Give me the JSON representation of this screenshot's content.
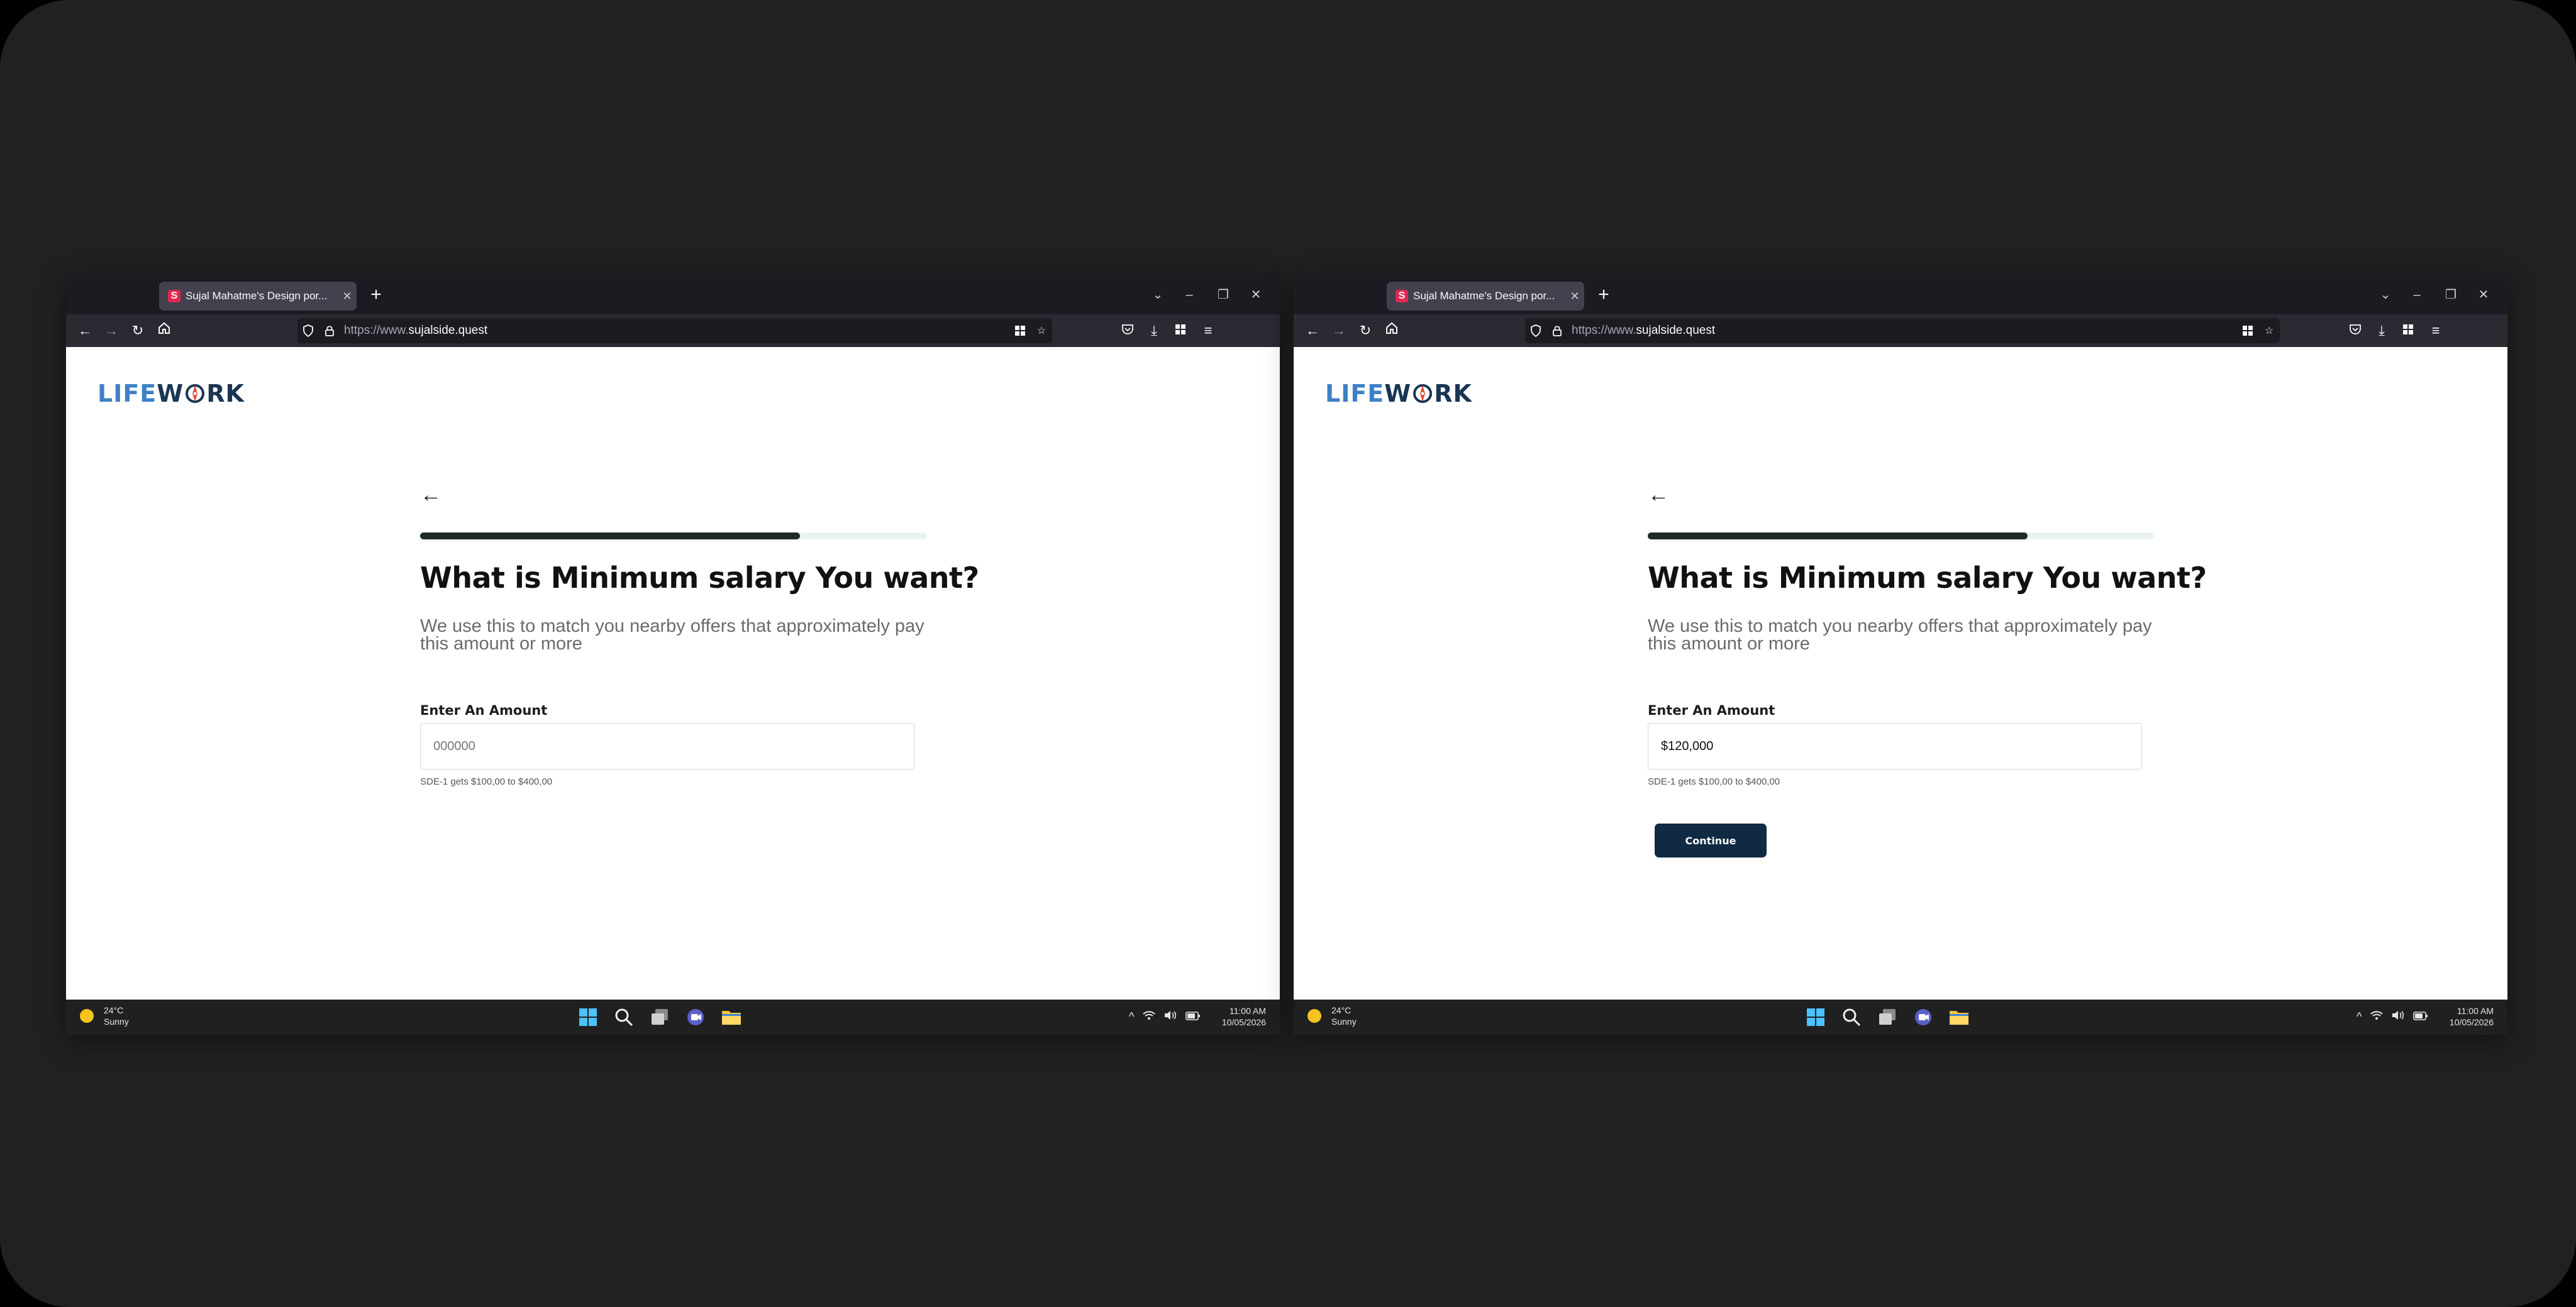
{
  "windows": [
    {
      "tab_title": "Sujal Mahatme's Design por...",
      "favicon_letter": "S",
      "url_prefix": "https://www.",
      "url_domain": "sujalside.quest",
      "brand": {
        "part1": "LIFE",
        "part2": "W",
        "part3": "RK"
      },
      "progress_fraction": 0.75,
      "heading": "What is Minimum salary You want?",
      "subtitle": "We use this to match you nearby offers that approximately pay this amount or more",
      "field_label": "Enter An Amount",
      "amount_value": "",
      "amount_placeholder": "000000",
      "hint": "SDE-1 gets $100,00 to $400,00",
      "continue_label": "",
      "weather_temp": "24°C",
      "weather_desc": "Sunny",
      "time": "11:00 AM",
      "date": "10/05/2026"
    },
    {
      "tab_title": "Sujal Mahatme's Design por...",
      "favicon_letter": "S",
      "url_prefix": "https://www.",
      "url_domain": "sujalside.quest",
      "brand": {
        "part1": "LIFE",
        "part2": "W",
        "part3": "RK"
      },
      "progress_fraction": 0.75,
      "heading": "What is Minimum salary You want?",
      "subtitle": "We use this to match you nearby offers that approximately pay this amount or more",
      "field_label": "Enter An Amount",
      "amount_value": "$120,000",
      "amount_placeholder": "000000",
      "hint": "SDE-1 gets $100,00 to $400,00",
      "continue_label": "Continue",
      "weather_temp": "24°C",
      "weather_desc": "Sunny",
      "time": "11:00 AM",
      "date": "10/05/2026"
    }
  ],
  "colors": {
    "progress_fill": "#1e2b28",
    "button_bg": "#0f2a42",
    "brand_light": "#3e80c5",
    "brand_dark": "#1a3654"
  },
  "icons": {
    "tabstrip": [
      "list-all-tabs-icon",
      "minimize-icon",
      "restore-icon",
      "close-window-icon"
    ],
    "nav": [
      "back-icon",
      "forward-icon",
      "reload-icon",
      "home-icon"
    ],
    "urlbar": [
      "tracking-shield-icon",
      "lock-icon",
      "qr-grid-icon",
      "bookmark-star-icon"
    ],
    "toolbar": [
      "pocket-icon",
      "downloads-icon",
      "extensions-icon",
      "menu-icon"
    ],
    "taskbar": [
      "windows-start-icon",
      "search-icon",
      "task-view-icon",
      "chat-icon",
      "file-explorer-icon"
    ],
    "tray": [
      "chevron-up-icon",
      "wifi-icon",
      "speaker-icon",
      "battery-icon"
    ]
  }
}
